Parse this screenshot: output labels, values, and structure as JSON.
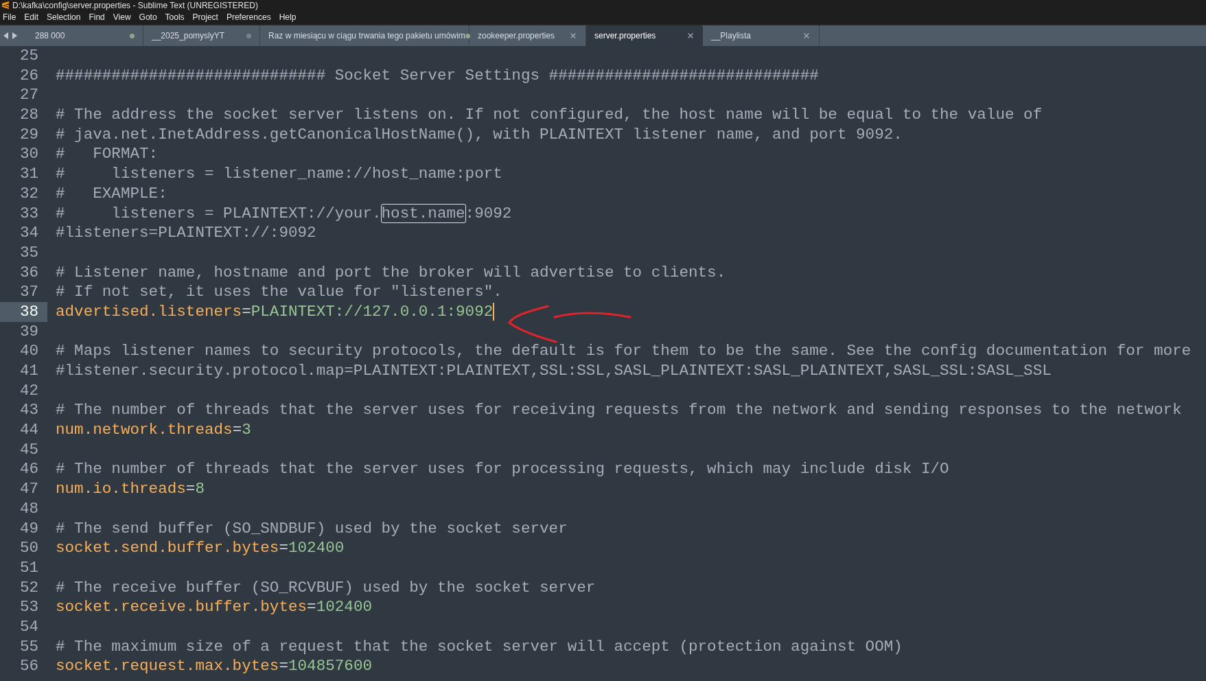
{
  "window": {
    "title": "D:\\kafka\\config\\server.properties - Sublime Text (UNREGISTERED)"
  },
  "menu": [
    "File",
    "Edit",
    "Selection",
    "Find",
    "View",
    "Goto",
    "Tools",
    "Project",
    "Preferences",
    "Help"
  ],
  "tabs": [
    {
      "label": "288 000",
      "selected": false,
      "kind": "modified",
      "color": "#8fa58b"
    },
    {
      "label": "__2025_pomyslyYT",
      "selected": false,
      "kind": "modified",
      "color": "#7d8288"
    },
    {
      "label": "Raz w miesiącu w ciągu trwania tego pakietu umówim",
      "selected": false,
      "kind": "modified",
      "color": "#8fa58b"
    },
    {
      "label": "zookeeper.properties",
      "selected": false,
      "kind": "closable"
    },
    {
      "label": "server.properties",
      "selected": true,
      "kind": "closable"
    },
    {
      "label": "__Playlista",
      "selected": false,
      "kind": "closable"
    }
  ],
  "lines": [
    {
      "number": "25",
      "kind": "blank"
    },
    {
      "number": "26",
      "kind": "comment",
      "text": "############################# Socket Server Settings #############################"
    },
    {
      "number": "27",
      "kind": "blank"
    },
    {
      "number": "28",
      "kind": "comment",
      "text": "# The address the socket server listens on. If not configured, the host name will be equal to the value of"
    },
    {
      "number": "29",
      "kind": "comment",
      "text": "# java.net.InetAddress.getCanonicalHostName(), with PLAINTEXT listener name, and port 9092."
    },
    {
      "number": "30",
      "kind": "comment",
      "text": "#   FORMAT:"
    },
    {
      "number": "31",
      "kind": "comment",
      "text": "#     listeners = listener_name://host_name:port"
    },
    {
      "number": "32",
      "kind": "comment",
      "text": "#   EXAMPLE:"
    },
    {
      "number": "33",
      "kind": "comment",
      "segments": [
        {
          "text": "#     listeners = PLAINTEXT://your.",
          "boxed": false
        },
        {
          "text": "host.name",
          "boxed": true
        },
        {
          "text": ":9092",
          "boxed": false
        }
      ]
    },
    {
      "number": "34",
      "kind": "comment",
      "text": "#listeners=PLAINTEXT://:9092"
    },
    {
      "number": "35",
      "kind": "blank"
    },
    {
      "number": "36",
      "kind": "comment",
      "text": "# Listener name, hostname and port the broker will advertise to clients."
    },
    {
      "number": "37",
      "kind": "comment",
      "text": "# If not set, it uses the value for \"listeners\"."
    },
    {
      "number": "38",
      "kind": "property",
      "key": "advertised.listeners",
      "sep": "=",
      "value": "PLAINTEXT://127.0.0.1:9092",
      "current": true
    },
    {
      "number": "39",
      "kind": "blank"
    },
    {
      "number": "40",
      "kind": "comment",
      "text": "# Maps listener names to security protocols, the default is for them to be the same. See the config documentation for more"
    },
    {
      "number": "41",
      "kind": "comment",
      "text": "#listener.security.protocol.map=PLAINTEXT:PLAINTEXT,SSL:SSL,SASL_PLAINTEXT:SASL_PLAINTEXT,SASL_SSL:SASL_SSL"
    },
    {
      "number": "42",
      "kind": "blank"
    },
    {
      "number": "43",
      "kind": "comment",
      "text": "# The number of threads that the server uses for receiving requests from the network and sending responses to the network"
    },
    {
      "number": "44",
      "kind": "property",
      "key": "num.network.threads",
      "sep": "=",
      "value": "3",
      "current": false
    },
    {
      "number": "45",
      "kind": "blank"
    },
    {
      "number": "46",
      "kind": "comment",
      "text": "# The number of threads that the server uses for processing requests, which may include disk I/O"
    },
    {
      "number": "47",
      "kind": "property",
      "key": "num.io.threads",
      "sep": "=",
      "value": "8",
      "current": false
    },
    {
      "number": "48",
      "kind": "blank"
    },
    {
      "number": "49",
      "kind": "comment",
      "text": "# The send buffer (SO_SNDBUF) used by the socket server"
    },
    {
      "number": "50",
      "kind": "property",
      "key": "socket.send.buffer.bytes",
      "sep": "=",
      "value": "102400",
      "current": false
    },
    {
      "number": "51",
      "kind": "blank"
    },
    {
      "number": "52",
      "kind": "comment",
      "text": "# The receive buffer (SO_RCVBUF) used by the socket server"
    },
    {
      "number": "53",
      "kind": "property",
      "key": "socket.receive.buffer.bytes",
      "sep": "=",
      "value": "102400",
      "current": false
    },
    {
      "number": "54",
      "kind": "blank"
    },
    {
      "number": "55",
      "kind": "comment",
      "text": "# The maximum size of a request that the socket server will accept (protection against OOM)"
    },
    {
      "number": "56",
      "kind": "property",
      "key": "socket.request.max.bytes",
      "sep": "=",
      "value": "104857600",
      "current": false
    }
  ]
}
